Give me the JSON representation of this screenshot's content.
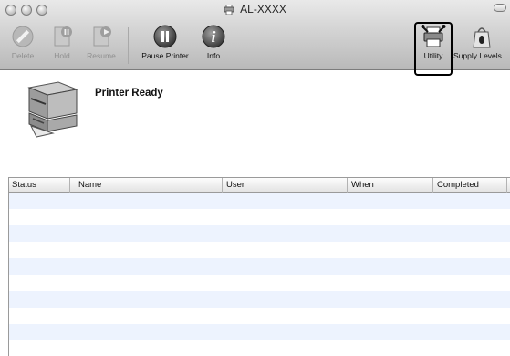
{
  "window": {
    "title": "AL-XXXX"
  },
  "toolbar": {
    "delete_label": "Delete",
    "hold_label": "Hold",
    "resume_label": "Resume",
    "pause_label": "Pause Printer",
    "info_label": "Info",
    "utility_label": "Utility",
    "supply_label": "Supply Levels"
  },
  "printer": {
    "status": "Printer Ready"
  },
  "jobs": {
    "columns": [
      "Status",
      "Name",
      "User",
      "When",
      "Completed"
    ],
    "rows": []
  },
  "colors": {
    "row_stripe": "#edf3fe",
    "highlight_border": "#000000"
  }
}
